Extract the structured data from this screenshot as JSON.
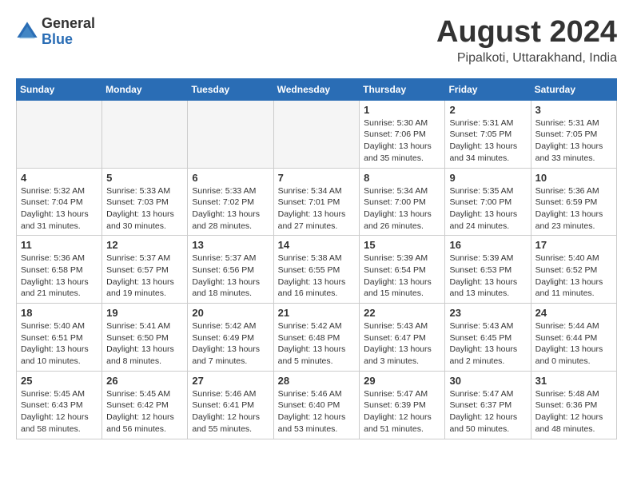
{
  "header": {
    "logo": {
      "line1": "General",
      "line2": "Blue"
    },
    "month_year": "August 2024",
    "location": "Pipalkoti, Uttarakhand, India"
  },
  "days_of_week": [
    "Sunday",
    "Monday",
    "Tuesday",
    "Wednesday",
    "Thursday",
    "Friday",
    "Saturday"
  ],
  "weeks": [
    [
      {
        "day": "",
        "detail": ""
      },
      {
        "day": "",
        "detail": ""
      },
      {
        "day": "",
        "detail": ""
      },
      {
        "day": "",
        "detail": ""
      },
      {
        "day": "1",
        "detail": "Sunrise: 5:30 AM\nSunset: 7:06 PM\nDaylight: 13 hours\nand 35 minutes."
      },
      {
        "day": "2",
        "detail": "Sunrise: 5:31 AM\nSunset: 7:05 PM\nDaylight: 13 hours\nand 34 minutes."
      },
      {
        "day": "3",
        "detail": "Sunrise: 5:31 AM\nSunset: 7:05 PM\nDaylight: 13 hours\nand 33 minutes."
      }
    ],
    [
      {
        "day": "4",
        "detail": "Sunrise: 5:32 AM\nSunset: 7:04 PM\nDaylight: 13 hours\nand 31 minutes."
      },
      {
        "day": "5",
        "detail": "Sunrise: 5:33 AM\nSunset: 7:03 PM\nDaylight: 13 hours\nand 30 minutes."
      },
      {
        "day": "6",
        "detail": "Sunrise: 5:33 AM\nSunset: 7:02 PM\nDaylight: 13 hours\nand 28 minutes."
      },
      {
        "day": "7",
        "detail": "Sunrise: 5:34 AM\nSunset: 7:01 PM\nDaylight: 13 hours\nand 27 minutes."
      },
      {
        "day": "8",
        "detail": "Sunrise: 5:34 AM\nSunset: 7:00 PM\nDaylight: 13 hours\nand 26 minutes."
      },
      {
        "day": "9",
        "detail": "Sunrise: 5:35 AM\nSunset: 7:00 PM\nDaylight: 13 hours\nand 24 minutes."
      },
      {
        "day": "10",
        "detail": "Sunrise: 5:36 AM\nSunset: 6:59 PM\nDaylight: 13 hours\nand 23 minutes."
      }
    ],
    [
      {
        "day": "11",
        "detail": "Sunrise: 5:36 AM\nSunset: 6:58 PM\nDaylight: 13 hours\nand 21 minutes."
      },
      {
        "day": "12",
        "detail": "Sunrise: 5:37 AM\nSunset: 6:57 PM\nDaylight: 13 hours\nand 19 minutes."
      },
      {
        "day": "13",
        "detail": "Sunrise: 5:37 AM\nSunset: 6:56 PM\nDaylight: 13 hours\nand 18 minutes."
      },
      {
        "day": "14",
        "detail": "Sunrise: 5:38 AM\nSunset: 6:55 PM\nDaylight: 13 hours\nand 16 minutes."
      },
      {
        "day": "15",
        "detail": "Sunrise: 5:39 AM\nSunset: 6:54 PM\nDaylight: 13 hours\nand 15 minutes."
      },
      {
        "day": "16",
        "detail": "Sunrise: 5:39 AM\nSunset: 6:53 PM\nDaylight: 13 hours\nand 13 minutes."
      },
      {
        "day": "17",
        "detail": "Sunrise: 5:40 AM\nSunset: 6:52 PM\nDaylight: 13 hours\nand 11 minutes."
      }
    ],
    [
      {
        "day": "18",
        "detail": "Sunrise: 5:40 AM\nSunset: 6:51 PM\nDaylight: 13 hours\nand 10 minutes."
      },
      {
        "day": "19",
        "detail": "Sunrise: 5:41 AM\nSunset: 6:50 PM\nDaylight: 13 hours\nand 8 minutes."
      },
      {
        "day": "20",
        "detail": "Sunrise: 5:42 AM\nSunset: 6:49 PM\nDaylight: 13 hours\nand 7 minutes."
      },
      {
        "day": "21",
        "detail": "Sunrise: 5:42 AM\nSunset: 6:48 PM\nDaylight: 13 hours\nand 5 minutes."
      },
      {
        "day": "22",
        "detail": "Sunrise: 5:43 AM\nSunset: 6:47 PM\nDaylight: 13 hours\nand 3 minutes."
      },
      {
        "day": "23",
        "detail": "Sunrise: 5:43 AM\nSunset: 6:45 PM\nDaylight: 13 hours\nand 2 minutes."
      },
      {
        "day": "24",
        "detail": "Sunrise: 5:44 AM\nSunset: 6:44 PM\nDaylight: 13 hours\nand 0 minutes."
      }
    ],
    [
      {
        "day": "25",
        "detail": "Sunrise: 5:45 AM\nSunset: 6:43 PM\nDaylight: 12 hours\nand 58 minutes."
      },
      {
        "day": "26",
        "detail": "Sunrise: 5:45 AM\nSunset: 6:42 PM\nDaylight: 12 hours\nand 56 minutes."
      },
      {
        "day": "27",
        "detail": "Sunrise: 5:46 AM\nSunset: 6:41 PM\nDaylight: 12 hours\nand 55 minutes."
      },
      {
        "day": "28",
        "detail": "Sunrise: 5:46 AM\nSunset: 6:40 PM\nDaylight: 12 hours\nand 53 minutes."
      },
      {
        "day": "29",
        "detail": "Sunrise: 5:47 AM\nSunset: 6:39 PM\nDaylight: 12 hours\nand 51 minutes."
      },
      {
        "day": "30",
        "detail": "Sunrise: 5:47 AM\nSunset: 6:37 PM\nDaylight: 12 hours\nand 50 minutes."
      },
      {
        "day": "31",
        "detail": "Sunrise: 5:48 AM\nSunset: 6:36 PM\nDaylight: 12 hours\nand 48 minutes."
      }
    ]
  ]
}
